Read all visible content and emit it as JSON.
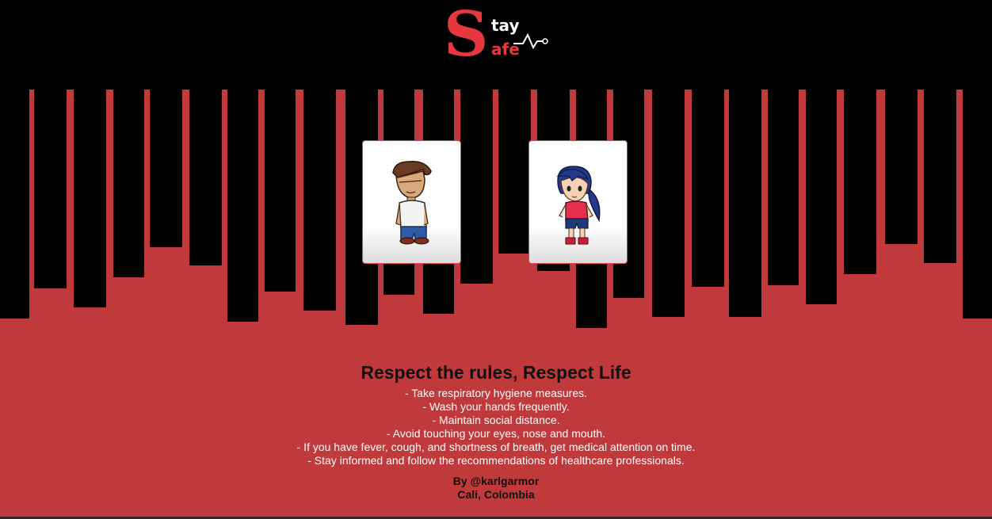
{
  "logo": {
    "big_letter": "S",
    "top_word": "tay",
    "bottom_word": "afe",
    "icon": "heartbeat-pulse-icon"
  },
  "characters": [
    {
      "name": "boy",
      "icon": "boy-character-icon"
    },
    {
      "name": "girl",
      "icon": "girl-character-icon"
    }
  ],
  "colors": {
    "background": "#000000",
    "accent_red": "#c13a3b",
    "logo_red": "#e8383f",
    "card_border": "#d84a4f"
  },
  "info": {
    "headline": "Respect the rules, Respect Life",
    "rules": [
      "- Take respiratory hygiene measures.",
      "- Wash your hands frequently.",
      "- Maintain social distance.",
      "- Avoid touching your eyes, nose and mouth.",
      "- If you have fever, cough, and shortness of breath, get medical attention on time.",
      "- Stay informed and follow the recommendations of healthcare professionals."
    ],
    "author": "By @karlgarmor",
    "location": "Cali, Colombia"
  }
}
